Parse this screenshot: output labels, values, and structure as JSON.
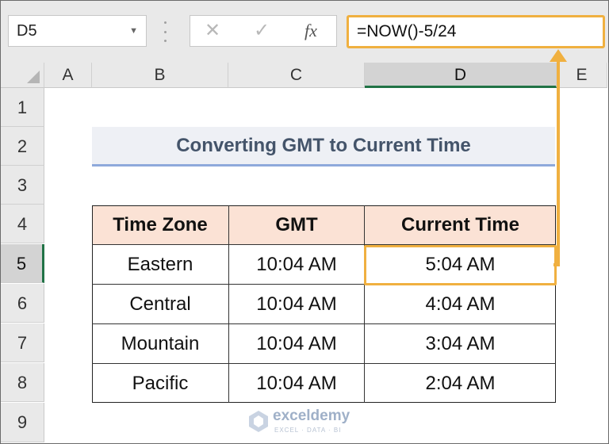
{
  "formula_bar": {
    "name_box": "D5",
    "cancel_symbol": "✕",
    "enter_symbol": "✓",
    "fx_label": "fx",
    "formula": "=NOW()-5/24"
  },
  "columns": [
    "A",
    "B",
    "C",
    "D",
    "E"
  ],
  "rows": [
    "1",
    "2",
    "3",
    "4",
    "5",
    "6",
    "7",
    "8",
    "9"
  ],
  "selected_cell": "D5",
  "sheet": {
    "title": "Converting GMT to Current Time",
    "headers": [
      "Time Zone",
      "GMT",
      "Current Time"
    ],
    "data": [
      [
        "Eastern",
        "10:04 AM",
        "5:04 AM"
      ],
      [
        "Central",
        "10:04 AM",
        "4:04 AM"
      ],
      [
        "Mountain",
        "10:04 AM",
        "3:04 AM"
      ],
      [
        "Pacific",
        "10:04 AM",
        "2:04 AM"
      ]
    ]
  },
  "watermark": {
    "name": "exceldemy",
    "tagline": "EXCEL · DATA · BI"
  },
  "colors": {
    "accent": "#f0b040",
    "selection": "#217346",
    "header_fill": "#fbe2d5",
    "title_text": "#44546a"
  }
}
